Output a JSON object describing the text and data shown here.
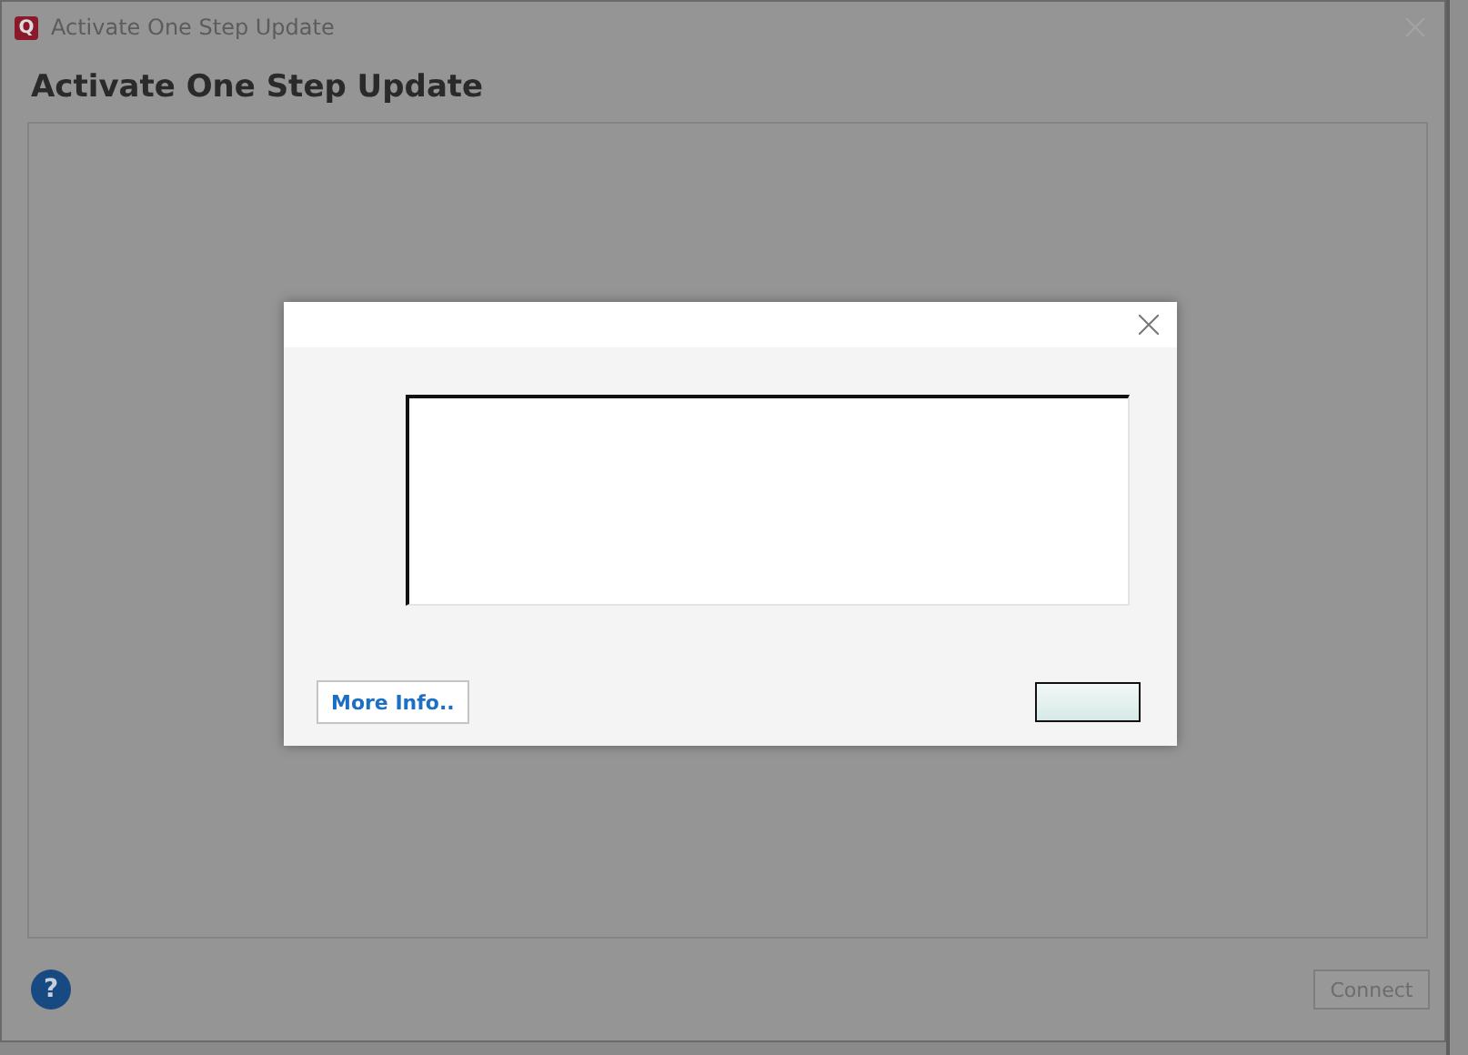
{
  "window": {
    "logo": "Q",
    "title": "Activate One Step Update"
  },
  "heading": "Activate One Step Update",
  "help_button": "?",
  "connect_button": {
    "label": "Connect",
    "disabled": true
  },
  "dialog": {
    "more_info_button": "More Info.."
  }
}
